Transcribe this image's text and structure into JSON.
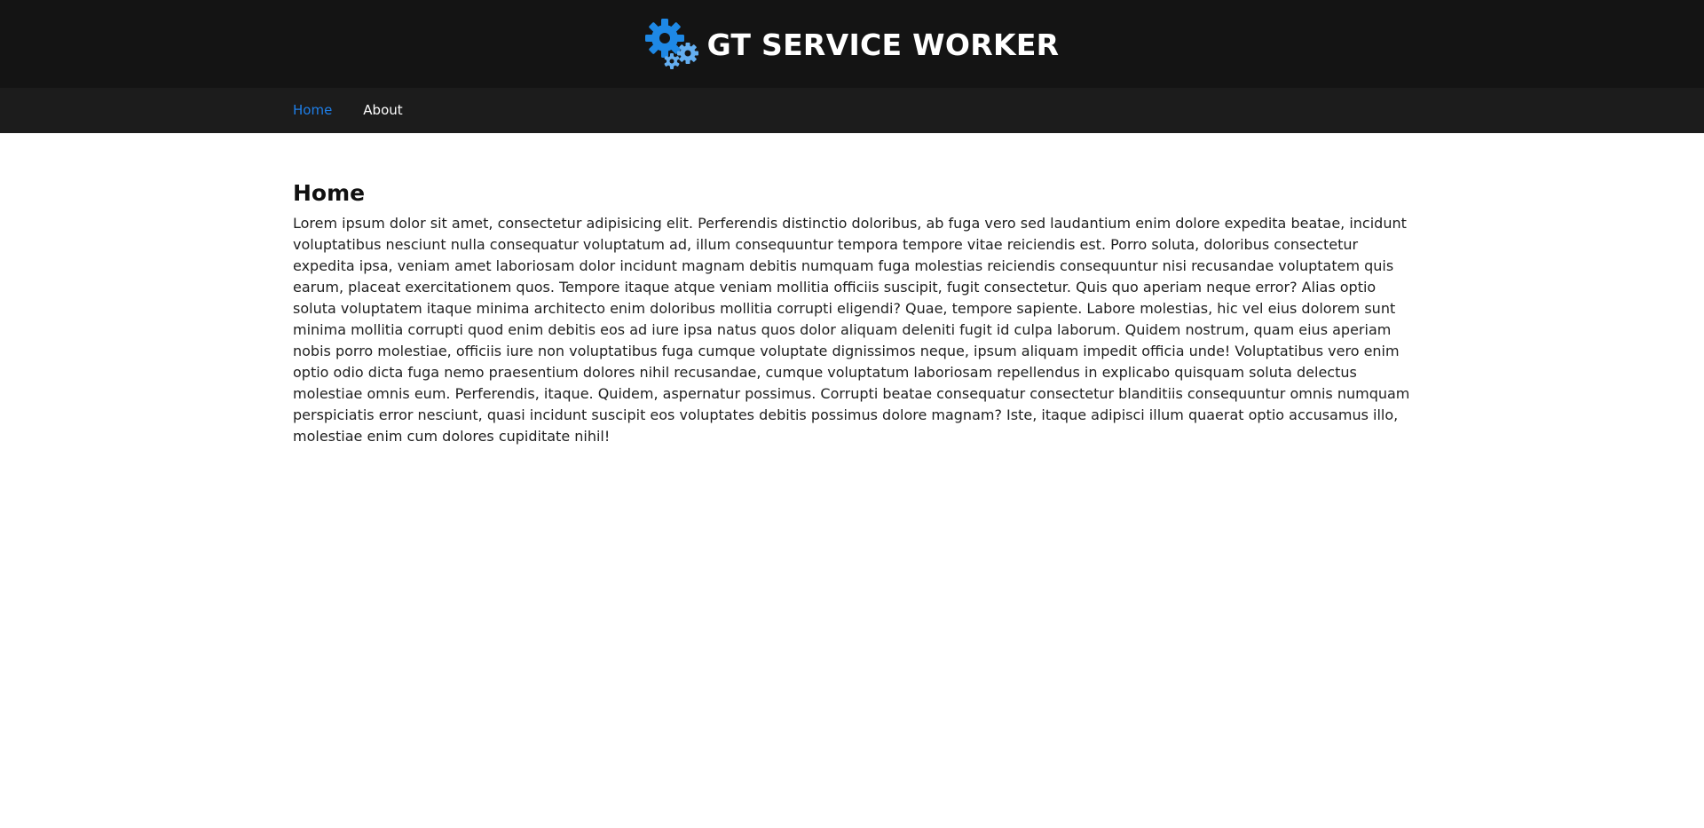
{
  "header": {
    "title": "GT SERVICE WORKER",
    "logo_icon": "gears-icon",
    "logo_color": "#1e88e5"
  },
  "nav": {
    "items": [
      {
        "label": "Home",
        "active": true
      },
      {
        "label": "About",
        "active": false
      }
    ],
    "active_color": "#1e7ee8"
  },
  "main": {
    "heading": "Home",
    "body": "Lorem ipsum dolor sit amet, consectetur adipisicing elit. Perferendis distinctio doloribus, ab fuga vero sed laudantium enim dolore expedita beatae, incidunt voluptatibus nesciunt nulla consequatur voluptatum ad, illum consequuntur tempora tempore vitae reiciendis est. Porro soluta, doloribus consectetur expedita ipsa, veniam amet laboriosam dolor incidunt magnam debitis numquam fuga molestias reiciendis consequuntur nisi recusandae voluptatem quis earum, placeat exercitationem quos. Tempore itaque atque veniam mollitia officiis suscipit, fugit consectetur. Quis quo aperiam neque error? Alias optio soluta voluptatem itaque minima architecto enim doloribus mollitia corrupti eligendi? Quae, tempore sapiente. Labore molestias, hic vel eius dolorem sunt minima mollitia corrupti quod enim debitis eos ad iure ipsa natus quos dolor aliquam deleniti fugit id culpa laborum. Quidem nostrum, quam eius aperiam nobis porro molestiae, officiis iure non voluptatibus fuga cumque voluptate dignissimos neque, ipsum aliquam impedit officia unde! Voluptatibus vero enim optio odio dicta fuga nemo praesentium dolores nihil recusandae, cumque voluptatum laboriosam repellendus in explicabo quisquam soluta delectus molestiae omnis eum. Perferendis, itaque. Quidem, aspernatur possimus. Corrupti beatae consequatur consectetur blanditiis consequuntur omnis numquam perspiciatis error nesciunt, quasi incidunt suscipit eos voluptates debitis possimus dolore magnam? Iste, itaque adipisci illum quaerat optio accusamus illo, molestiae enim cum dolores cupiditate nihil!"
  }
}
